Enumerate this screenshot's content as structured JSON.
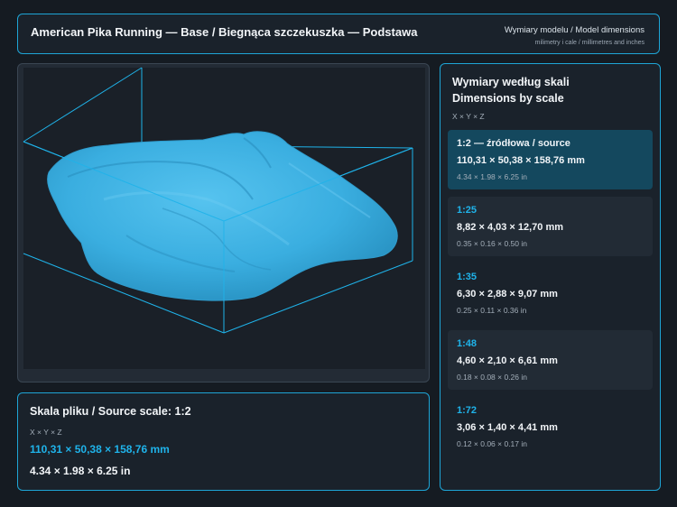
{
  "header": {
    "title": "American Pika Running — Base / Biegnąca szczekuszka — Podstawa",
    "subtitle_line1": "Wymiary modelu / Model dimensions",
    "subtitle_line2": "milimetry i cale / millimetres and inches"
  },
  "viewer": {
    "model_color": "#3cb6ea",
    "box_color": "#1fb3ea"
  },
  "source_panel": {
    "heading": "Skala pliku / Source scale: 1:2",
    "axes": "X × Y × Z",
    "mm": "110,31 × 50,38 × 158,76 mm",
    "inches": "4.34 × 1.98 × 6.25 in"
  },
  "scales_panel": {
    "heading_line1": "Wymiary według skali",
    "heading_line2": "Dimensions by scale",
    "axes": "X × Y × Z",
    "cards": [
      {
        "scale": "1:2  —  źródłowa / source",
        "mm": "110,31 × 50,38 × 158,76 mm",
        "inches": "4.34 × 1.98 × 6.25 in",
        "active": true
      },
      {
        "scale": "1:25",
        "mm": "8,82 × 4,03 × 12,70 mm",
        "inches": "0.35 × 0.16 × 0.50 in"
      },
      {
        "scale": "1:35",
        "mm": "6,30 × 2,88 × 9,07 mm",
        "inches": "0.25 × 0.11 × 0.36 in"
      },
      {
        "scale": "1:48",
        "mm": "4,60 × 2,10 × 6,61 mm",
        "inches": "0.18 × 0.08 × 0.26 in"
      },
      {
        "scale": "1:72",
        "mm": "3,06 × 1,40 × 4,41 mm",
        "inches": "0.12 × 0.06 × 0.17 in"
      }
    ]
  },
  "colors": {
    "accent": "#1fb3ea",
    "active_card": "#14485e",
    "background": "#151b22"
  }
}
